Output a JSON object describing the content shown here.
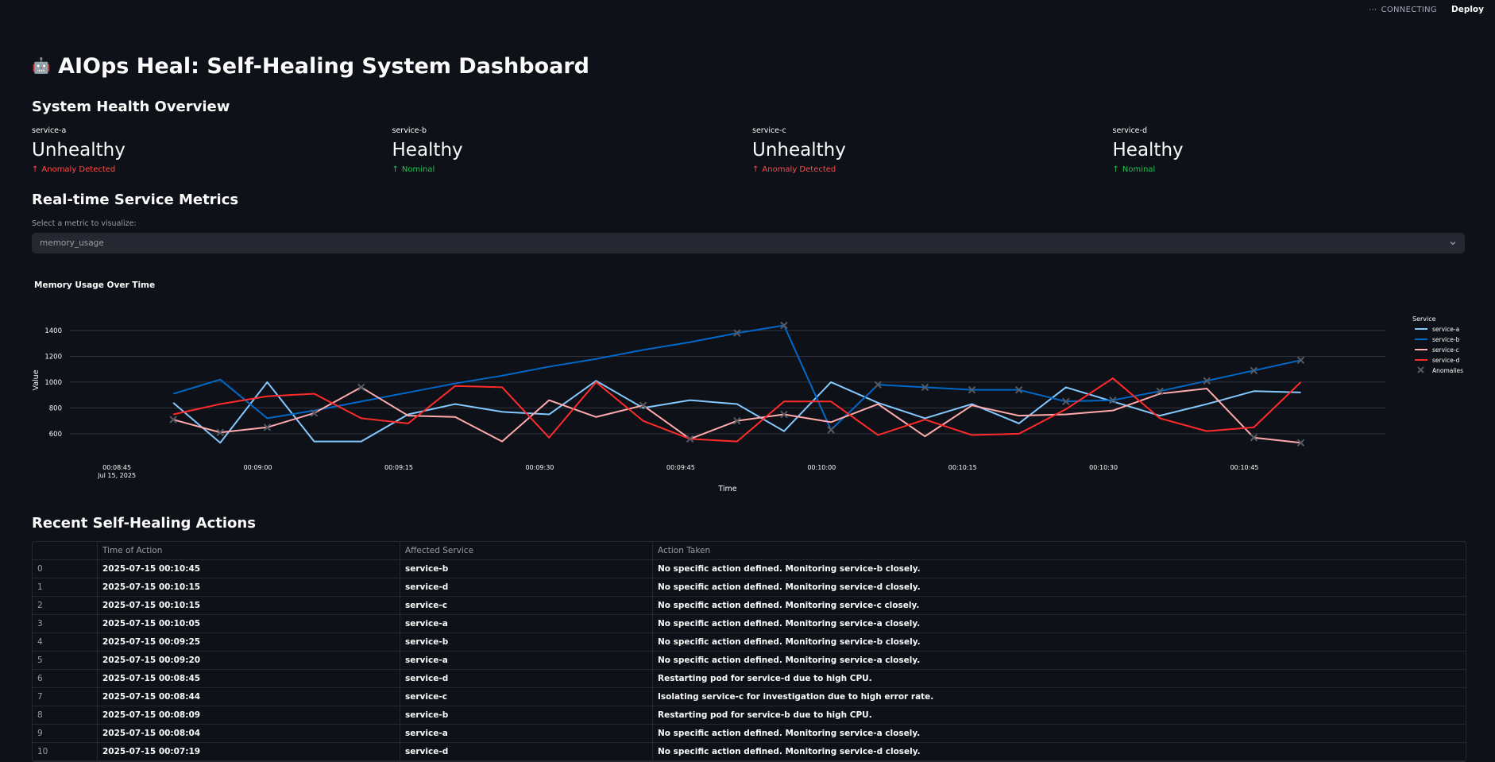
{
  "topbar": {
    "status": "CONNECTING",
    "deploy_label": "Deploy"
  },
  "page": {
    "title": "AIOps Heal: Self-Healing System Dashboard",
    "title_emoji": "🤖",
    "health_heading": "System Health Overview",
    "metrics_heading": "Real-time Service Metrics",
    "actions_heading": "Recent Self-Healing Actions"
  },
  "health": [
    {
      "service": "service-a",
      "status": "Unhealthy",
      "delta": "Anomaly Detected",
      "healthy": false
    },
    {
      "service": "service-b",
      "status": "Healthy",
      "delta": "Nominal",
      "healthy": true
    },
    {
      "service": "service-c",
      "status": "Unhealthy",
      "delta": "Anomaly Detected",
      "healthy": false
    },
    {
      "service": "service-d",
      "status": "Healthy",
      "delta": "Nominal",
      "healthy": true
    }
  ],
  "metric_select": {
    "label": "Select a metric to visualize:",
    "value": "memory_usage"
  },
  "chart_title": "Memory Usage Over Time",
  "chart_data": {
    "type": "line",
    "title": "Memory Usage Over Time",
    "xlabel": "Time",
    "ylabel": "Value",
    "ylim": [
      470,
      1560
    ],
    "yticks": [
      600,
      800,
      1000,
      1200,
      1400
    ],
    "x_tick_labels": [
      "00:08:45",
      "00:09:00",
      "00:09:15",
      "00:09:30",
      "00:09:45",
      "00:10:00",
      "00:10:15",
      "00:10:30",
      "00:10:45"
    ],
    "x_tick_sublabel": "Jul 15, 2025",
    "x_tick_seconds": [
      525,
      540,
      555,
      570,
      585,
      600,
      615,
      630,
      645
    ],
    "x": [
      531,
      536,
      541,
      546,
      551,
      556,
      561,
      566,
      571,
      576,
      581,
      586,
      591,
      596,
      601,
      606,
      611,
      616,
      621,
      626,
      631,
      636,
      641,
      646,
      651
    ],
    "legend_title": "Service",
    "anomaly_label": "Anomalies",
    "series": [
      {
        "name": "service-a",
        "color": "#83c9ff",
        "values": [
          840,
          530,
          1000,
          540,
          540,
          750,
          830,
          770,
          750,
          1010,
          800,
          860,
          830,
          620,
          1000,
          840,
          720,
          830,
          680,
          960,
          850,
          740,
          830,
          930,
          920
        ],
        "anomalies": []
      },
      {
        "name": "service-b",
        "color": "#0068c9",
        "values": [
          910,
          1020,
          720,
          780,
          850,
          920,
          990,
          1050,
          1120,
          1180,
          1250,
          1310,
          1380,
          1440,
          630,
          980,
          960,
          940,
          940,
          850,
          860,
          930,
          1010,
          1090,
          1170
        ],
        "anomalies": [
          12,
          13,
          14,
          15,
          16,
          17,
          18,
          19,
          20,
          21,
          22,
          23,
          24
        ]
      },
      {
        "name": "service-c",
        "color": "#ffabab",
        "values": [
          710,
          610,
          650,
          760,
          960,
          740,
          730,
          540,
          860,
          730,
          820,
          560,
          700,
          750,
          690,
          830,
          580,
          820,
          740,
          750,
          780,
          910,
          950,
          570,
          530
        ],
        "anomalies": [
          0,
          1,
          2,
          3,
          4,
          10,
          11,
          12,
          13,
          23,
          24
        ]
      },
      {
        "name": "service-d",
        "color": "#ff2b2b",
        "values": [
          750,
          830,
          890,
          910,
          720,
          680,
          970,
          960,
          570,
          1000,
          700,
          560,
          540,
          850,
          850,
          590,
          710,
          590,
          600,
          790,
          1030,
          720,
          620,
          650,
          1000
        ],
        "anomalies": []
      }
    ]
  },
  "actions_table": {
    "columns": [
      "",
      "Time of Action",
      "Affected Service",
      "Action Taken"
    ],
    "rows": [
      [
        "0",
        "2025-07-15 00:10:45",
        "service-b",
        "No specific action defined. Monitoring service-b closely."
      ],
      [
        "1",
        "2025-07-15 00:10:15",
        "service-d",
        "No specific action defined. Monitoring service-d closely."
      ],
      [
        "2",
        "2025-07-15 00:10:15",
        "service-c",
        "No specific action defined. Monitoring service-c closely."
      ],
      [
        "3",
        "2025-07-15 00:10:05",
        "service-a",
        "No specific action defined. Monitoring service-a closely."
      ],
      [
        "4",
        "2025-07-15 00:09:25",
        "service-b",
        "No specific action defined. Monitoring service-b closely."
      ],
      [
        "5",
        "2025-07-15 00:09:20",
        "service-a",
        "No specific action defined. Monitoring service-a closely."
      ],
      [
        "6",
        "2025-07-15 00:08:45",
        "service-d",
        "Restarting pod for service-d due to high CPU."
      ],
      [
        "7",
        "2025-07-15 00:08:44",
        "service-c",
        "Isolating service-c for investigation due to high error rate."
      ],
      [
        "8",
        "2025-07-15 00:08:09",
        "service-b",
        "Restarting pod for service-b due to high CPU."
      ],
      [
        "9",
        "2025-07-15 00:08:04",
        "service-a",
        "No specific action defined. Monitoring service-a closely."
      ],
      [
        "10",
        "2025-07-15 00:07:19",
        "service-d",
        "No specific action defined. Monitoring service-d closely."
      ]
    ]
  }
}
